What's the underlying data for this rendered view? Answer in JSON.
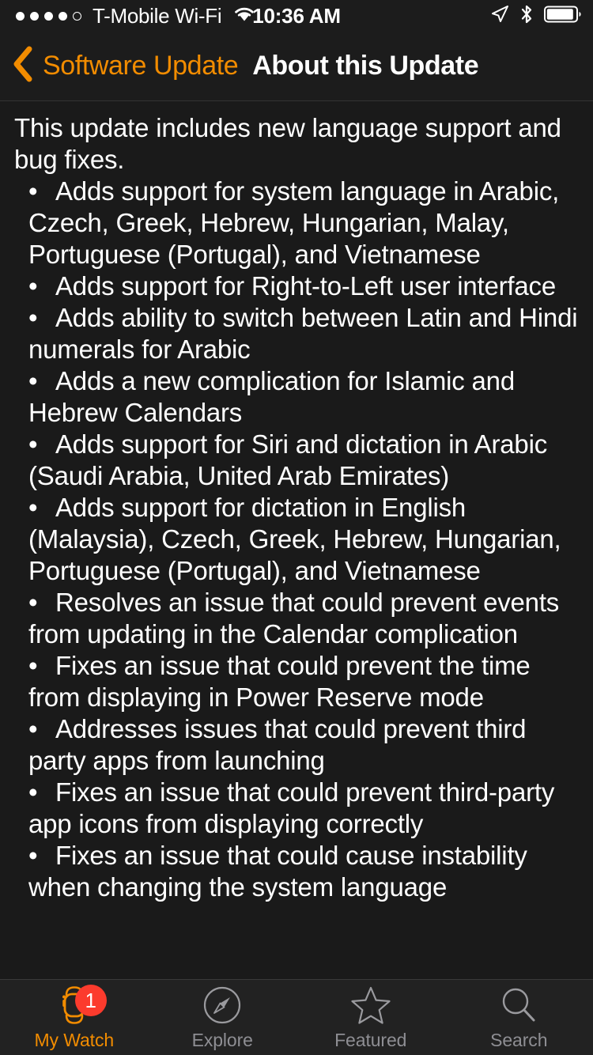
{
  "status_bar": {
    "signal_dots": {
      "total": 5,
      "filled": 4
    },
    "carrier": "T-Mobile Wi-Fi",
    "wifi_icon": "wifi-icon",
    "time": "10:36 AM",
    "location_icon": "location-arrow-icon",
    "bluetooth_icon": "bluetooth-icon",
    "battery_icon": "battery-icon",
    "battery_level_percent": 85
  },
  "nav_bar": {
    "back_icon": "chevron-left-icon",
    "back_label": "Software Update",
    "title": "About this Update",
    "accent_color": "#F28C00"
  },
  "content": {
    "intro": "This update includes new language support and bug fixes.",
    "bullet_glyph": "•",
    "bullets": [
      "Adds support for system language in Arabic, Czech, Greek, Hebrew, Hungarian, Malay, Portuguese (Portugal), and Vietnamese",
      "Adds support for Right-to-Left user interface",
      "Adds ability to switch between Latin and Hindi numerals for Arabic",
      "Adds a new complication for Islamic and Hebrew Calendars",
      "Adds support for Siri and dictation in Arabic (Saudi Arabia, United Arab Emirates)",
      "Adds support for dictation in English (Malaysia), Czech, Greek, Hebrew, Hungarian, Portuguese (Portugal), and Vietnamese",
      "Resolves an issue that could prevent events from updating in the Calendar complication",
      "Fixes an issue that could prevent the time from displaying in Power Reserve mode",
      "Addresses issues that could prevent third party apps from launching",
      "Fixes an issue that could prevent third-party app icons from displaying correctly",
      "Fixes an issue that could cause instability when changing the system language"
    ]
  },
  "tab_bar": {
    "active_color": "#F28C00",
    "inactive_color": "#8e8e93",
    "badge_color": "#FC3B2D",
    "tabs": [
      {
        "label": "My Watch",
        "icon": "watch-icon",
        "active": true,
        "badge": "1"
      },
      {
        "label": "Explore",
        "icon": "compass-icon",
        "active": false,
        "badge": ""
      },
      {
        "label": "Featured",
        "icon": "star-icon",
        "active": false,
        "badge": ""
      },
      {
        "label": "Search",
        "icon": "magnifier-icon",
        "active": false,
        "badge": ""
      }
    ]
  }
}
